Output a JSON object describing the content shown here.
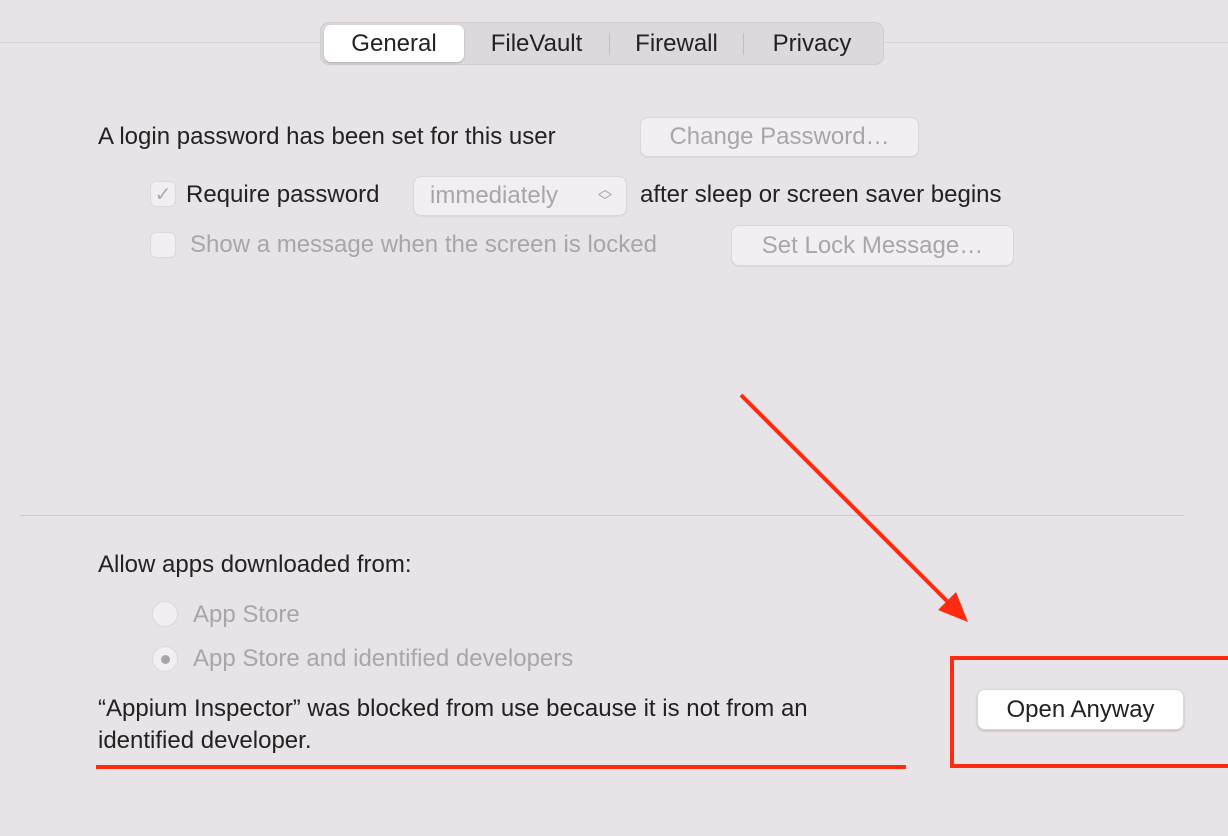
{
  "tabs": [
    {
      "label": "General",
      "active": true
    },
    {
      "label": "FileVault"
    },
    {
      "label": "Firewall"
    },
    {
      "label": "Privacy"
    }
  ],
  "login": {
    "text": "A login password has been set for this user",
    "change_button": "Change Password…"
  },
  "require": {
    "checked": true,
    "label": "Require password",
    "popup_value": "immediately",
    "suffix": "after sleep or screen saver begins"
  },
  "message": {
    "checked": false,
    "label": "Show a message when the screen is locked",
    "button": "Set Lock Message…"
  },
  "allow": {
    "heading": "Allow apps downloaded from:",
    "options": [
      {
        "label": "App Store",
        "selected": false
      },
      {
        "label": "App Store and identified developers",
        "selected": true
      }
    ]
  },
  "blocked": {
    "line1": "“Appium Inspector” was blocked from use because it is not from an",
    "line2": "identified developer.",
    "button": "Open Anyway"
  },
  "annotation_color": "#ff2a10"
}
